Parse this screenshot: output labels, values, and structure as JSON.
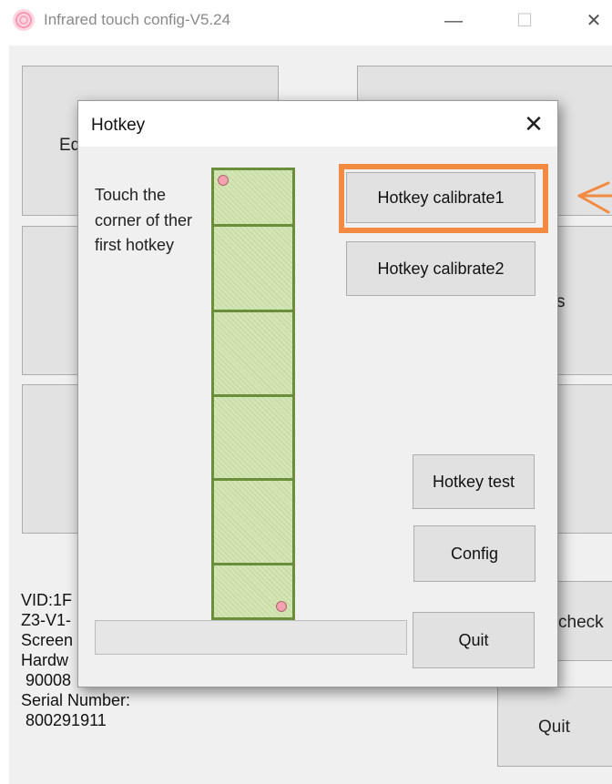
{
  "window": {
    "title": "Infrared touch config-V5.24",
    "minimize_glyph": "—",
    "maximize_glyph": "☐",
    "close_glyph": "✕"
  },
  "background": {
    "button_top_left_label": "Eq",
    "button_mid_right_label": "s",
    "check_button_label": "check",
    "quit_button_label": "Quit",
    "info_lines": [
      "VID:1F",
      "Z3-V1-",
      "Screen",
      "Hardw",
      " 90008",
      "Serial Number:",
      " 800291911"
    ]
  },
  "dialog": {
    "title": "Hotkey",
    "close_glyph": "✕",
    "instruction": "Touch the corner of ther first hotkey",
    "buttons": {
      "calibrate1": "Hotkey calibrate1",
      "calibrate2": "Hotkey calibrate2",
      "test": "Hotkey test",
      "config": "Config",
      "quit": "Quit"
    },
    "hotkey_cells": 6,
    "progress": 0
  },
  "colors": {
    "highlight": "#f28a41",
    "cell_fill": "#d4e5b4",
    "cell_border": "#6b8e3a",
    "marker_dot": "#f2a3b0"
  },
  "icons": [
    "fingerprint-app-icon",
    "close-icon",
    "arrow-annotation-icon"
  ]
}
